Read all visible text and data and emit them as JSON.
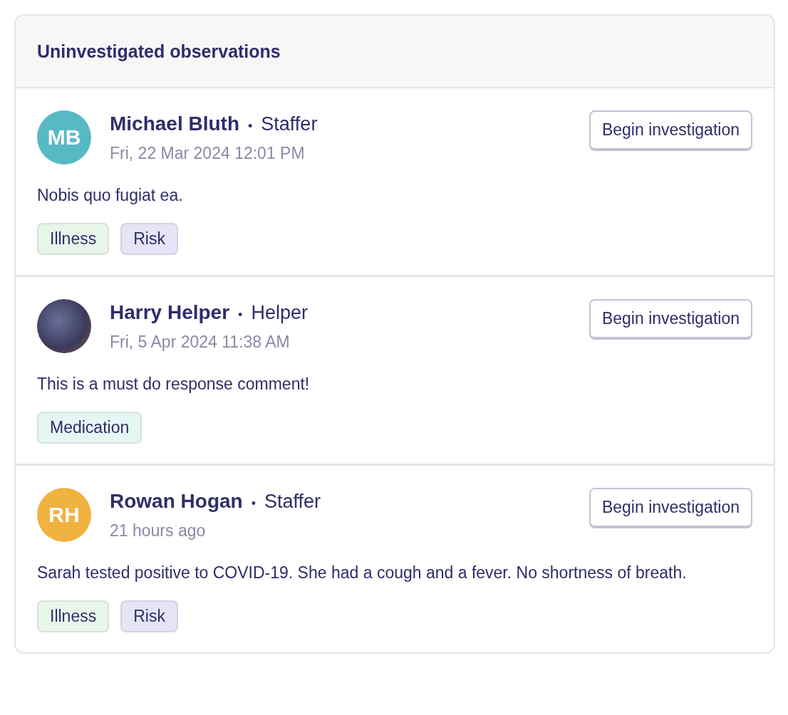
{
  "panel": {
    "title": "Uninvestigated observations"
  },
  "observations": [
    {
      "avatar": {
        "kind": "initials",
        "initials": "MB",
        "color": "#57b9c4"
      },
      "name": "Michael Bluth",
      "separator": "•",
      "role": "Staffer",
      "time": "Fri, 22 Mar 2024 12:01 PM",
      "text": "Nobis quo fugiat ea.",
      "action": "Begin investigation",
      "tags": [
        {
          "label": "Illness",
          "color": "#e8f6ea"
        },
        {
          "label": "Risk",
          "color": "#e6e5f6"
        }
      ]
    },
    {
      "avatar": {
        "kind": "photo"
      },
      "name": "Harry Helper",
      "separator": "•",
      "role": "Helper",
      "time": "Fri, 5 Apr 2024 11:38 AM",
      "text": "This is a must do response comment!",
      "action": "Begin investigation",
      "tags": [
        {
          "label": "Medication",
          "color": "#e5f6f3"
        }
      ]
    },
    {
      "avatar": {
        "kind": "initials",
        "initials": "RH",
        "color": "#f0b240"
      },
      "name": "Rowan Hogan",
      "separator": "•",
      "role": "Staffer",
      "time": "21 hours ago",
      "text": "Sarah tested positive to COVID-19. She had a cough and a fever. No shortness of breath.",
      "action": "Begin investigation",
      "tags": [
        {
          "label": "Illness",
          "color": "#e8f6ea"
        },
        {
          "label": "Risk",
          "color": "#e6e5f6"
        }
      ]
    }
  ]
}
